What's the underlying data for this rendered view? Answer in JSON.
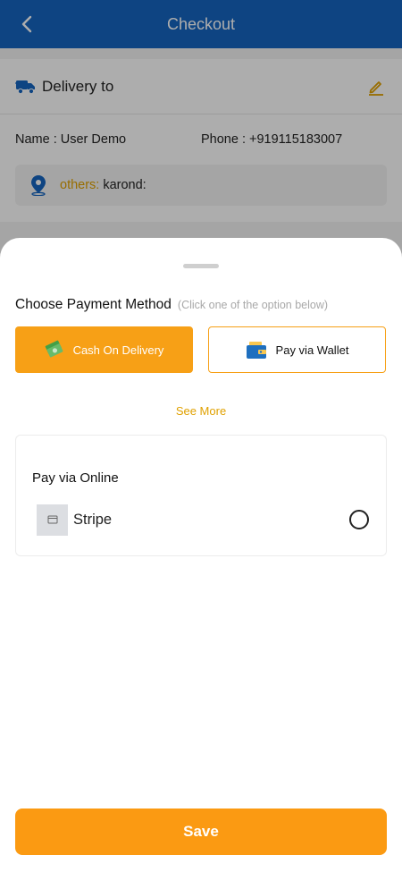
{
  "header": {
    "title": "Checkout",
    "back_icon": "chevron-left-icon"
  },
  "delivery": {
    "title": "Delivery to",
    "truck_icon": "truck-icon",
    "edit_icon": "edit-pencil-icon",
    "name_label": "Name : ",
    "name_value": "User Demo",
    "phone_label": "Phone : ",
    "phone_value": "+919115183007",
    "address_type": "others:",
    "address_text": "karond:"
  },
  "payment_sheet": {
    "title": "Choose Payment Method",
    "hint": "(Click one of the option below)",
    "options": [
      {
        "label": "Cash On Delivery",
        "icon": "cash-icon",
        "selected": true
      },
      {
        "label": "Pay via Wallet",
        "icon": "wallet-icon",
        "selected": false
      }
    ],
    "see_more": "See More",
    "online": {
      "title": "Pay via Online",
      "methods": [
        {
          "label": "Stripe",
          "icon": "stripe-logo-icon",
          "selected": false
        }
      ]
    },
    "save_label": "Save"
  },
  "colors": {
    "header": "#1565c0",
    "accent": "#f7a016",
    "address_type": "#e0a100"
  }
}
